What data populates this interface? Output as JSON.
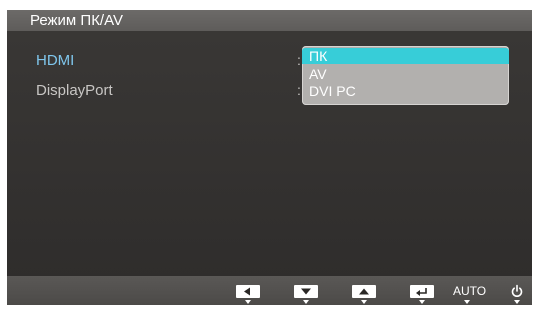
{
  "title": "Режим ПК/AV",
  "menu": {
    "items": [
      {
        "label": "HDMI"
      },
      {
        "label": "DisplayPort"
      }
    ],
    "separator": ":"
  },
  "dropdown": {
    "options": [
      "ПК",
      "AV",
      "DVI PC"
    ],
    "selected": "ПК"
  },
  "footer": {
    "buttons": [
      "left-icon",
      "down-icon",
      "up-icon",
      "enter-icon",
      "AUTO",
      "power-icon"
    ],
    "auto_label": "AUTO"
  },
  "colors": {
    "background": "#2e2c2b",
    "titlebar": "#5e5c5a",
    "highlight_text": "#7fc6ec",
    "dropdown_bg": "#b2b0ae",
    "selection": "#37cdd8"
  }
}
